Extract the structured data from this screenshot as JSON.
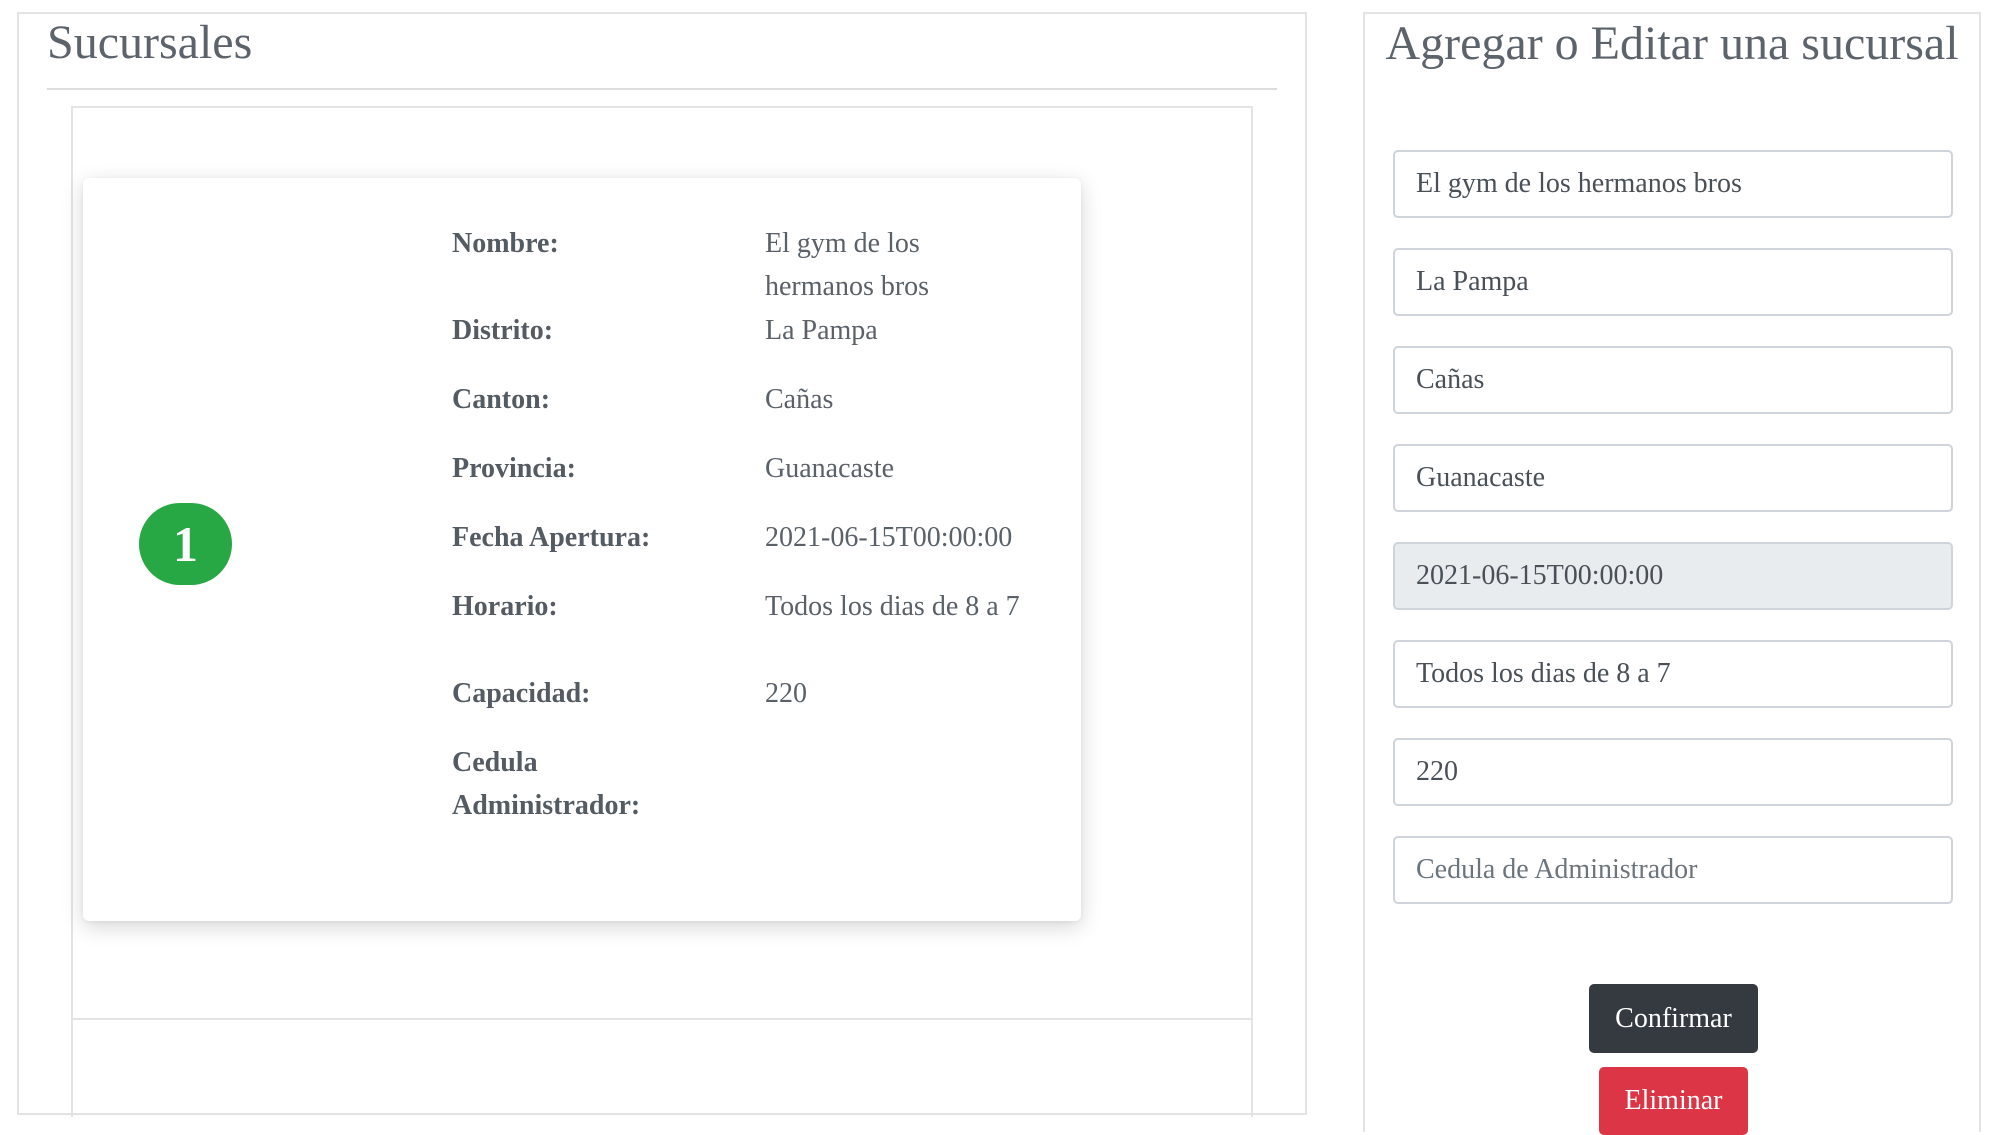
{
  "branches_panel": {
    "title": "Sucursales",
    "branch": {
      "index_badge": "1",
      "fields": [
        {
          "label": "Nombre:",
          "value": "El gym de los hermanos bros"
        },
        {
          "label": "Distrito:",
          "value": "La Pampa"
        },
        {
          "label": "Canton:",
          "value": "Cañas"
        },
        {
          "label": "Provincia:",
          "value": "Guanacaste"
        },
        {
          "label": "Fecha Apertura:",
          "value": "2021-06-15T00:00:00"
        },
        {
          "label": "Horario:",
          "value": "Todos los dias de 8 a 7"
        },
        {
          "label": "Capacidad:",
          "value": "220"
        },
        {
          "label": "Cedula Administrador:",
          "value": ""
        }
      ]
    }
  },
  "form_panel": {
    "title": "Agregar o Editar una sucursal",
    "inputs": {
      "name": {
        "value": "El gym de los hermanos bros",
        "placeholder": ""
      },
      "district": {
        "value": "La Pampa",
        "placeholder": ""
      },
      "canton": {
        "value": "Cañas",
        "placeholder": ""
      },
      "province": {
        "value": "Guanacaste",
        "placeholder": ""
      },
      "opening_date": {
        "value": "2021-06-15T00:00:00",
        "placeholder": ""
      },
      "schedule": {
        "value": "Todos los dias de 8 a 7",
        "placeholder": ""
      },
      "capacity": {
        "value": "220",
        "placeholder": ""
      },
      "admin_id": {
        "value": "",
        "placeholder": "Cedula de Administrador"
      }
    },
    "confirm_label": "Confirmar",
    "delete_label": "Eliminar"
  },
  "colors": {
    "badge": "#28a745",
    "confirm_button": "#343a40",
    "delete_button": "#dc3545",
    "readonly_input": "#e9ecef"
  }
}
